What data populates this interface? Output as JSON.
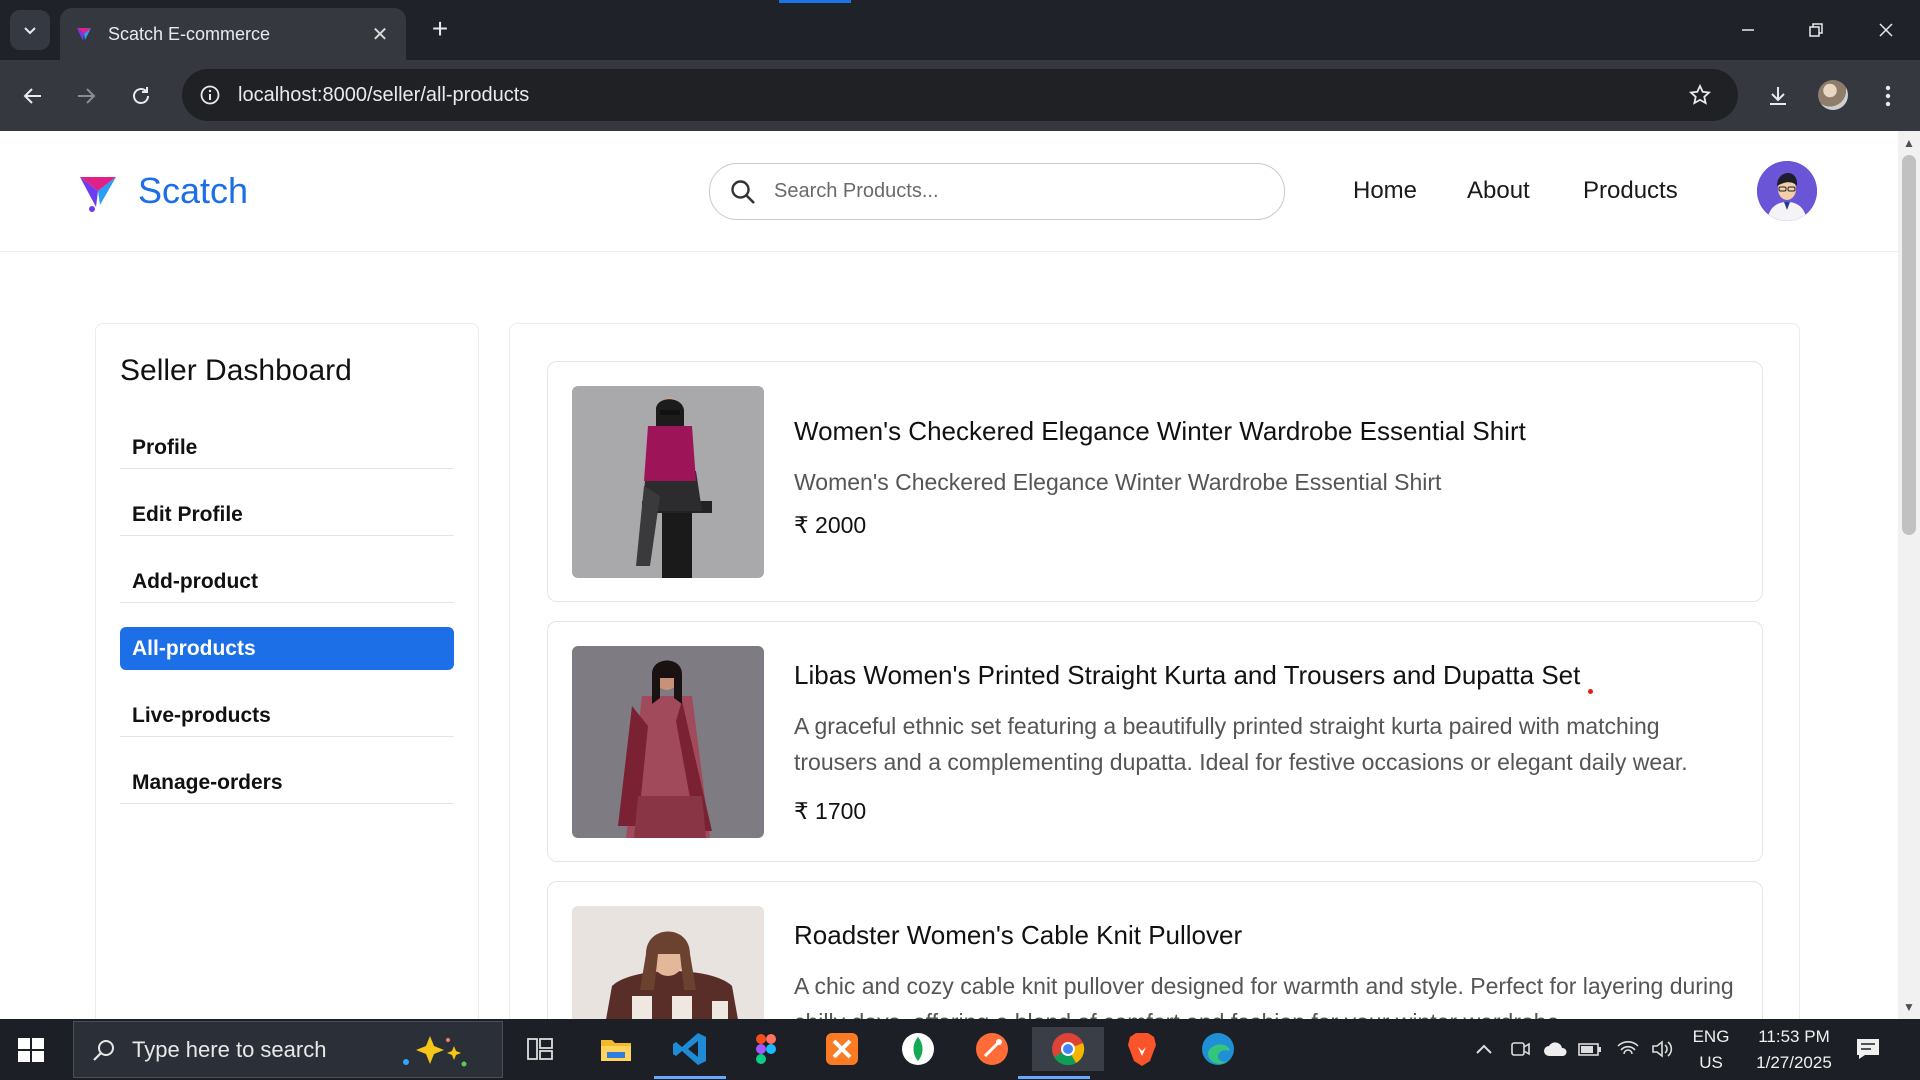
{
  "browser": {
    "tab_title": "Scatch E-commerce",
    "url": "localhost:8000/seller/all-products"
  },
  "header": {
    "brand": "Scatch",
    "search_placeholder": "Search Products...",
    "nav": [
      "Home",
      "About",
      "Products"
    ]
  },
  "sidebar": {
    "title": "Seller Dashboard",
    "items": [
      {
        "label": "Profile"
      },
      {
        "label": "Edit Profile"
      },
      {
        "label": "Add-product"
      },
      {
        "label": "All-products",
        "active": true
      },
      {
        "label": "Live-products"
      },
      {
        "label": "Manage-orders"
      }
    ]
  },
  "products": [
    {
      "title": "Women's Checkered Elegance Winter Wardrobe Essential Shirt",
      "description": "Women's Checkered Elegance Winter Wardrobe Essential Shirt",
      "price": "₹ 2000"
    },
    {
      "title": "Libas Women's Printed Straight Kurta and Trousers and Dupatta Set",
      "description": "A graceful ethnic set featuring a beautifully printed straight kurta paired with matching trousers and a complementing dupatta. Ideal for festive occasions or elegant daily wear.",
      "price": "₹ 1700"
    },
    {
      "title": "Roadster Women's Cable Knit Pullover",
      "description": "A chic and cozy cable knit pullover designed for warmth and style. Perfect for layering during chilly days, offering a blend of comfort and fashion for your winter wardrobe.",
      "price": ""
    }
  ],
  "taskbar": {
    "search_placeholder": "Type here to search",
    "lang_top": "ENG",
    "lang_bottom": "US",
    "time": "11:53 PM",
    "date": "1/27/2025"
  },
  "colors": {
    "accent": "#1c6fe6",
    "browser_frame": "#1f2329",
    "toolbar": "#35393f"
  }
}
